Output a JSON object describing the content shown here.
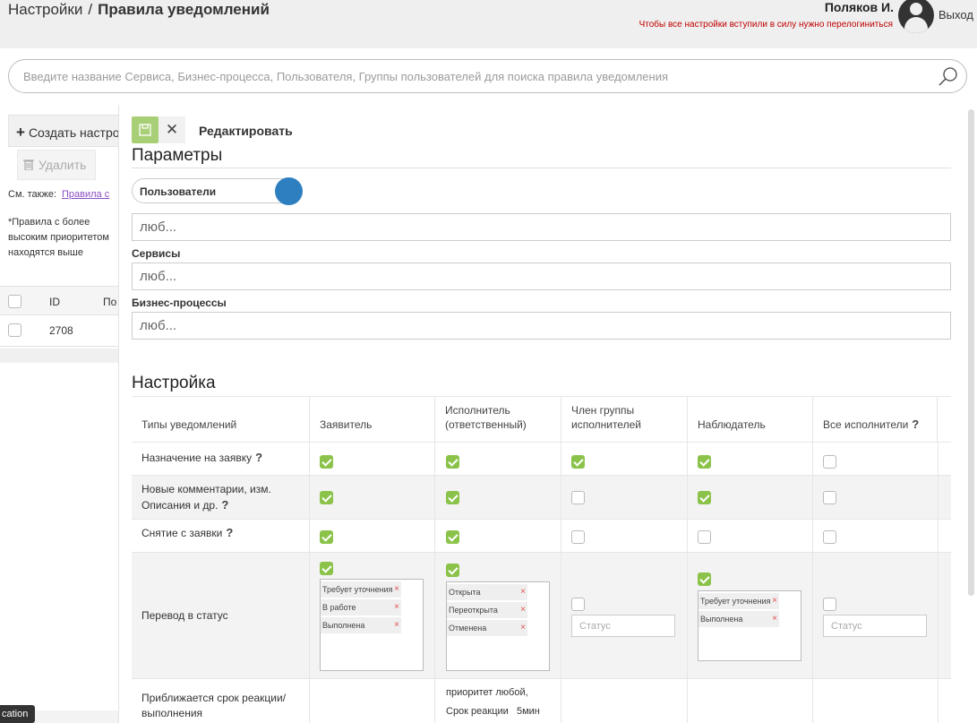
{
  "header": {
    "breadcrumb_root": "Настройки",
    "breadcrumb_sep": "/",
    "breadcrumb_current": "Правила уведомлений",
    "user_name": "Поляков И.",
    "relogin_note": "Чтобы все настройки вступили в силу нужно перелогиниться",
    "logout_label": "Выход"
  },
  "search": {
    "placeholder": "Введите название Сервиса, Бизнес-процесса, Пользователя, Группы пользователей для поиска правила уведомления"
  },
  "left": {
    "create_label": "Создать настро",
    "delete_label": "Удалить",
    "see_also_label": "См. также:",
    "see_also_link": "Правила с",
    "priority_note": "*Правила с более высоким приоритетом находятся выше",
    "table_headers": [
      "ID",
      "По"
    ],
    "rows": [
      {
        "id": "2708"
      }
    ],
    "tooltip": "cation"
  },
  "editor": {
    "edit_label": "Редактировать",
    "cancel_symbol": "✕",
    "params_title": "Параметры",
    "toggle_label": "Пользователи",
    "users_placeholder": "люб...",
    "services_label": "Сервисы",
    "services_placeholder": "люб...",
    "bp_label": "Бизнес-процессы",
    "bp_placeholder": "люб...",
    "setup_title": "Настройка"
  },
  "grid": {
    "columns": [
      "Типы уведомлений",
      "Заявитель",
      "Исполнитель\n(ответственный)",
      "Член группы\nисполнителей",
      "Наблюдатель",
      "Все исполнители"
    ],
    "help_mark": "?",
    "rows": [
      {
        "label": "Назначение на заявку",
        "help": true,
        "checks": [
          true,
          true,
          true,
          true,
          false
        ]
      },
      {
        "label": "Новые комментарии, изм. Описания и др.",
        "help": true,
        "checks": [
          true,
          true,
          false,
          true,
          false
        ]
      },
      {
        "label": "Снятие с заявки",
        "help": true,
        "checks": [
          true,
          true,
          false,
          false,
          false
        ]
      },
      {
        "label": "Перевод в статус",
        "help": false,
        "checks": [
          true,
          true,
          false,
          true,
          false
        ]
      },
      {
        "label": "Приближается срок реакции/ выполнения",
        "help": false
      }
    ],
    "status_lists": {
      "applicant": [
        "Требует уточнения",
        "В работе",
        "Выполнена"
      ],
      "executor": [
        "Открыта",
        "Переоткрыта",
        "Отменена"
      ],
      "observer": [
        "Требует уточнения",
        "Выполнена"
      ]
    },
    "remove_symbol": "×",
    "status_placeholder": "Статус",
    "deadline_text_1": "приоритет любой,",
    "deadline_text_2": "Срок реакции   5мин"
  }
}
